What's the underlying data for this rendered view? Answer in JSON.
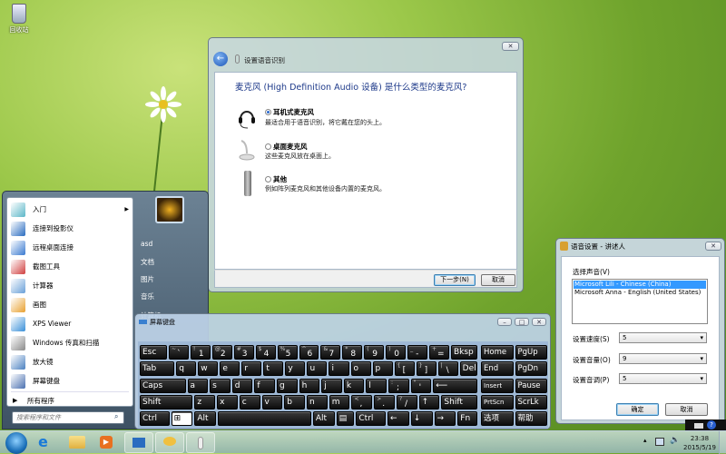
{
  "desktop": {
    "recycle_bin": "回收站"
  },
  "setup_dialog": {
    "title": "设置语音识别",
    "heading": "麦克风 (High Definition Audio 设备) 是什么类型的麦克风?",
    "options": [
      {
        "label": "耳机式麦克风",
        "desc": "最适合用于语音识别，将它戴在您的头上。",
        "selected": true,
        "icon": "headset-icon"
      },
      {
        "label": "桌面麦克风",
        "desc": "这些麦克风放在桌面上。",
        "selected": false,
        "icon": "desktop-mic-icon"
      },
      {
        "label": "其他",
        "desc": "例如阵列麦克风和其他设备内置的麦克风。",
        "selected": false,
        "icon": "handheld-mic-icon"
      }
    ],
    "next": "下一步(N)",
    "cancel": "取消"
  },
  "start_menu": {
    "items": [
      {
        "label": "入门",
        "color": "#5bb7c8",
        "arrow": true
      },
      {
        "label": "连接到投影仪",
        "color": "#2a6cc0"
      },
      {
        "label": "远程桌面连接",
        "color": "#3a7ad0"
      },
      {
        "label": "截图工具",
        "color": "#d04040"
      },
      {
        "label": "计算器",
        "color": "#6aa0d8"
      },
      {
        "label": "画图",
        "color": "#e8a030"
      },
      {
        "label": "XPS Viewer",
        "color": "#3a90d8"
      },
      {
        "label": "Windows 传真和扫描",
        "color": "#8a8a8a"
      },
      {
        "label": "放大镜",
        "color": "#4a80c0"
      },
      {
        "label": "屏幕键盘",
        "color": "#4a70b0"
      }
    ],
    "all_programs": "所有程序",
    "search_placeholder": "搜索程序和文件",
    "right": [
      "asd",
      "文档",
      "图片",
      "音乐",
      "计算机"
    ]
  },
  "osk": {
    "title": "屏幕键盘",
    "rows": [
      [
        [
          "",
          "Esc"
        ],
        [
          "~",
          "`"
        ],
        [
          "!",
          "1"
        ],
        [
          "@",
          "2"
        ],
        [
          "#",
          "3"
        ],
        [
          "$",
          "4"
        ],
        [
          "%",
          "5"
        ],
        [
          "^",
          "6"
        ],
        [
          "&",
          "7"
        ],
        [
          "*",
          "8"
        ],
        [
          "(",
          "9"
        ],
        [
          ")",
          "0"
        ],
        [
          "_",
          "-"
        ],
        [
          "+",
          "="
        ],
        [
          "",
          "Bksp"
        ]
      ],
      [
        [
          "",
          "Tab"
        ],
        [
          "",
          "q"
        ],
        [
          "",
          "w"
        ],
        [
          "",
          "e"
        ],
        [
          "",
          "r"
        ],
        [
          "",
          "t"
        ],
        [
          "",
          "y"
        ],
        [
          "",
          "u"
        ],
        [
          "",
          "i"
        ],
        [
          "",
          "o"
        ],
        [
          "",
          "p"
        ],
        [
          "{",
          "["
        ],
        [
          "}",
          "]"
        ],
        [
          "|",
          "\\"
        ],
        [
          "",
          "Del"
        ]
      ],
      [
        [
          "",
          "Caps"
        ],
        [
          "",
          "a"
        ],
        [
          "",
          "s"
        ],
        [
          "",
          "d"
        ],
        [
          "",
          "f"
        ],
        [
          "",
          "g"
        ],
        [
          "",
          "h"
        ],
        [
          "",
          "j"
        ],
        [
          "",
          "k"
        ],
        [
          "",
          "l"
        ],
        [
          ":",
          ";"
        ],
        [
          "\"",
          "'"
        ],
        [
          "",
          "⟵"
        ]
      ],
      [
        [
          "",
          "Shift"
        ],
        [
          "",
          "z"
        ],
        [
          "",
          "x"
        ],
        [
          "",
          "c"
        ],
        [
          "",
          "v"
        ],
        [
          "",
          "b"
        ],
        [
          "",
          "n"
        ],
        [
          "",
          "m"
        ],
        [
          "<",
          ","
        ],
        [
          ">",
          "."
        ],
        [
          "?",
          "/"
        ],
        [
          "",
          "↑"
        ],
        [
          "",
          "Shift"
        ]
      ],
      [
        [
          "",
          "Ctrl"
        ],
        [
          "",
          "⊞"
        ],
        [
          "",
          "Alt"
        ],
        [
          "",
          ""
        ],
        [
          "",
          "Alt"
        ],
        [
          "",
          "▤"
        ],
        [
          "",
          "Ctrl"
        ],
        [
          "",
          "←"
        ],
        [
          "",
          "↓"
        ],
        [
          "",
          "→"
        ],
        [
          "",
          "Fn"
        ]
      ]
    ],
    "nav": [
      [
        "Home",
        "PgUp"
      ],
      [
        "End",
        "PgDn"
      ],
      [
        "Insert",
        "Pause"
      ],
      [
        "PrtScn",
        "ScrLk"
      ],
      [
        "选项",
        "帮助"
      ]
    ]
  },
  "voice": {
    "title": "语音设置 - 讲述人",
    "select_label": "选择声音(V)",
    "voices": [
      "Microsoft Lili - Chinese (China)",
      "Microsoft Anna - English (United States)"
    ],
    "selected_voice": 0,
    "speed_label": "设置速度(S)",
    "speed": "5",
    "volume_label": "设置音量(O)",
    "volume": "9",
    "pitch_label": "设置音调(P)",
    "pitch": "5",
    "ok": "确定",
    "cancel": "取消"
  },
  "taskbar": {
    "time": "23:38",
    "date": "2015/5/19"
  }
}
